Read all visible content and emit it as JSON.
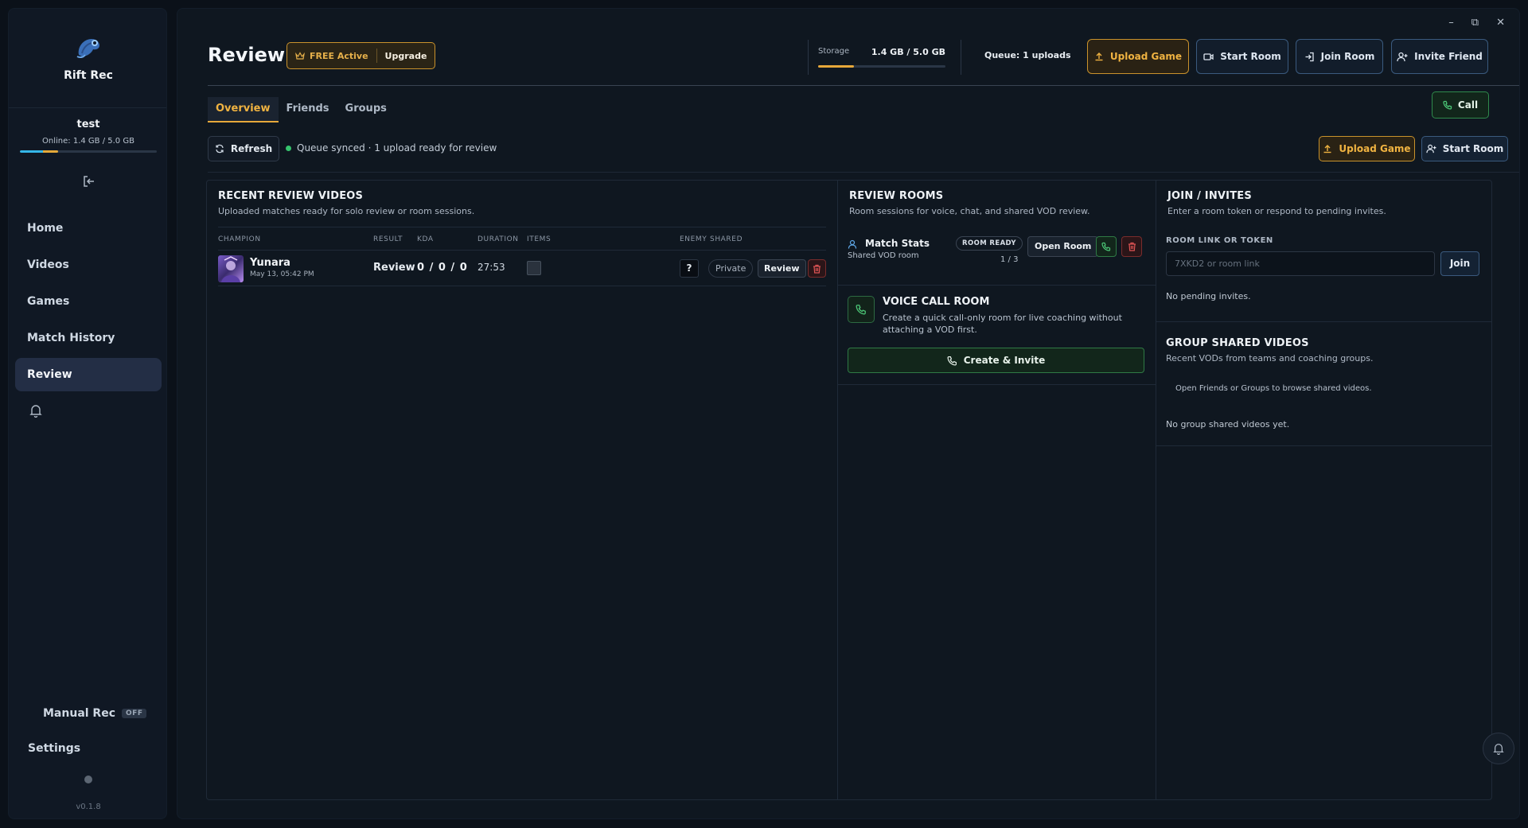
{
  "app": {
    "name": "Rift Rec",
    "version": "v0.1.8"
  },
  "user": {
    "name": "test",
    "online_text": "Online: 1.4 GB / 5.0 GB",
    "storage_fraction": 0.28
  },
  "sidebar": {
    "items": [
      {
        "label": "Home",
        "active": false
      },
      {
        "label": "Videos",
        "active": false
      },
      {
        "label": "Games",
        "active": false
      },
      {
        "label": "Match History",
        "active": false
      },
      {
        "label": "Review",
        "active": true
      }
    ],
    "manual_rec_label": "Manual Rec",
    "manual_rec_state": "OFF",
    "settings_label": "Settings"
  },
  "header": {
    "title": "Review",
    "plan_label": "FREE Active",
    "upgrade_label": "Upgrade",
    "storage_label": "Storage",
    "storage_value": "1.4 GB / 5.0 GB",
    "storage_fraction": 0.28,
    "queue_text": "Queue: 1 uploads",
    "buttons": {
      "upload_game": "Upload Game",
      "start_room": "Start Room",
      "join_room": "Join Room",
      "invite_friend": "Invite Friend"
    }
  },
  "tabs": [
    {
      "label": "Overview",
      "active": true
    },
    {
      "label": "Friends",
      "active": false
    },
    {
      "label": "Groups",
      "active": false
    }
  ],
  "call_label": "Call",
  "toolbar": {
    "refresh_label": "Refresh",
    "sync_status": "Queue synced · 1 upload ready for review",
    "upload_game_label": "Upload Game",
    "start_room_label": "Start Room"
  },
  "recent": {
    "title": "RECENT REVIEW VIDEOS",
    "subtitle": "Uploaded matches ready for solo review or room sessions.",
    "columns": [
      "CHAMPION",
      "RESULT",
      "KDA",
      "DURATION",
      "ITEMS",
      "ENEMY",
      "SHARED"
    ],
    "rows": [
      {
        "champion": "Yunara",
        "date": "May 13, 05:42 PM",
        "result": "Review",
        "kda": "0 / 0 / 0",
        "duration": "27:53",
        "enemy": "?",
        "shared": "Private",
        "review_label": "Review"
      }
    ]
  },
  "rooms": {
    "title": "REVIEW ROOMS",
    "subtitle": "Room sessions for voice, chat, and shared VOD review.",
    "items": [
      {
        "name": "Match Stats",
        "sub": "Shared VOD room",
        "badge": "ROOM READY",
        "count": "1 / 3",
        "open_label": "Open Room"
      }
    ],
    "voice": {
      "title": "VOICE CALL ROOM",
      "desc": "Create a quick call-only room for live coaching without attaching a VOD first.",
      "button": "Create & Invite"
    }
  },
  "join": {
    "title": "JOIN / INVITES",
    "subtitle": "Enter a room token or respond to pending invites.",
    "field_label": "ROOM LINK OR TOKEN",
    "placeholder": "7XKD2 or room link",
    "join_label": "Join",
    "no_invites": "No pending invites."
  },
  "groups": {
    "title": "GROUP SHARED VIDEOS",
    "subtitle": "Recent VODs from teams and coaching groups.",
    "hint": "Open Friends or Groups to browse shared videos.",
    "empty": "No group shared videos yet."
  },
  "colors": {
    "accent_gold": "#e6a83a",
    "accent_blue": "#35b6e8",
    "success_green": "#36c46d",
    "danger_red": "#c94040"
  }
}
